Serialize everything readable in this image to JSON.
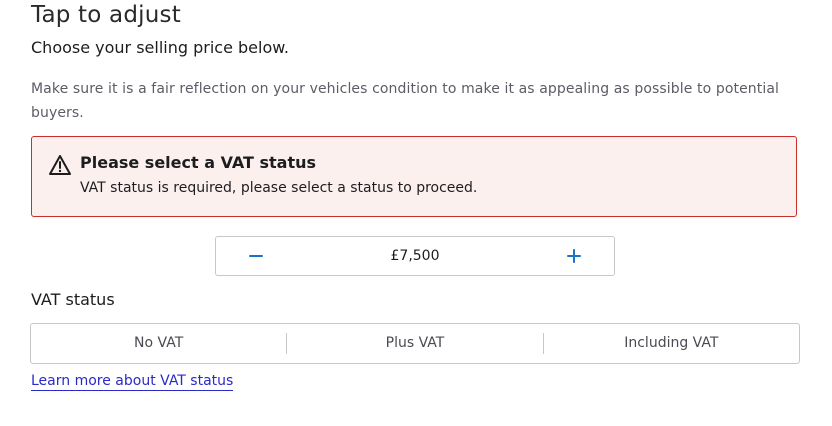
{
  "header": {
    "title": "Tap to adjust",
    "subtitle": "Choose your selling price below.",
    "description": "Make sure it is a fair reflection on your vehicles condition to make it as appealing as possible to potential buyers."
  },
  "alert": {
    "icon": "warning-icon",
    "title": "Please select a VAT status",
    "message": "VAT status is required, please select a status to proceed.",
    "border_color": "#c9302c",
    "background_color": "#fcf0ef"
  },
  "price_stepper": {
    "value": "£7,500",
    "decrease_icon": "minus-icon",
    "increase_icon": "plus-icon",
    "accent_color": "#1a73c9"
  },
  "vat": {
    "label": "VAT status",
    "options": [
      "No VAT",
      "Plus VAT",
      "Including VAT"
    ]
  },
  "link": {
    "label": "Learn more about VAT status",
    "color": "#2a2ac8"
  }
}
